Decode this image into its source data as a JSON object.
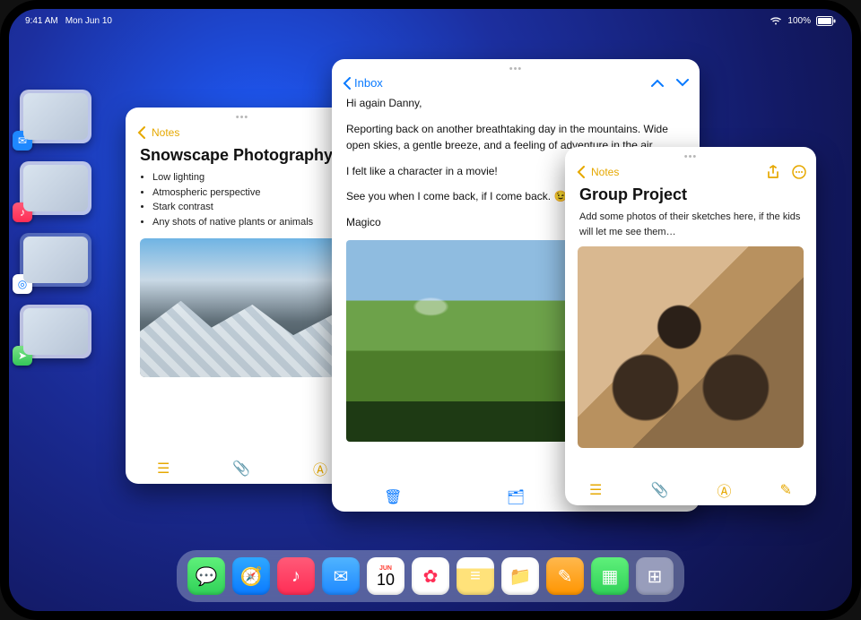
{
  "status": {
    "time": "9:41 AM",
    "date": "Mon Jun 10",
    "battery_pct": "100%"
  },
  "stage": {
    "items": [
      {
        "app": "Mail",
        "badge_bg": "#1e88ff"
      },
      {
        "app": "Music",
        "badge_bg": "#ff2d55"
      },
      {
        "app": "Safari",
        "badge_bg": "#ffffff"
      },
      {
        "app": "Maps",
        "badge_bg": "#34c759"
      }
    ]
  },
  "notes_left": {
    "back_label": "Notes",
    "title": "Snowscape Photography",
    "bullets": [
      "Low lighting",
      "Atmospheric perspective",
      "Stark contrast",
      "Any shots of native plants or animals"
    ]
  },
  "mail": {
    "back_label": "Inbox",
    "greeting": "Hi again Danny,",
    "p1": "Reporting back on another breathtaking day in the mountains. Wide open skies, a gentle breeze, and a feeling of adventure in the air.",
    "p2": "I felt like a character in a movie!",
    "p3": "See you when I come back, if I come back. 😉",
    "signoff": "Magico"
  },
  "notes_right": {
    "back_label": "Notes",
    "title": "Group Project",
    "body": "Add some photos of their sketches here, if the kids will let me see them…"
  },
  "calendar": {
    "month": "JUN",
    "day": "10"
  },
  "dock": [
    {
      "name": "messages",
      "bg": "#30d158",
      "glyph": "💬"
    },
    {
      "name": "safari",
      "bg": "#ffffff",
      "glyph": "🧭"
    },
    {
      "name": "music",
      "bg": "#ffffff",
      "glyph": "🎵"
    },
    {
      "name": "mail",
      "bg": "#1e88ff",
      "glyph": "✉️"
    },
    {
      "name": "calendar",
      "bg": "#ffffff",
      "glyph": ""
    },
    {
      "name": "photos",
      "bg": "#ffffff",
      "glyph": "🌸"
    },
    {
      "name": "notes",
      "bg": "#fff27a",
      "glyph": "📝"
    },
    {
      "name": "files",
      "bg": "#ffffff",
      "glyph": "📁"
    },
    {
      "name": "pages",
      "bg": "#ff9500",
      "glyph": "📄"
    },
    {
      "name": "numbers",
      "bg": "#30d158",
      "glyph": "📊"
    },
    {
      "name": "shortcuts",
      "bg": "#5e5ce6",
      "glyph": "⚙️"
    }
  ]
}
